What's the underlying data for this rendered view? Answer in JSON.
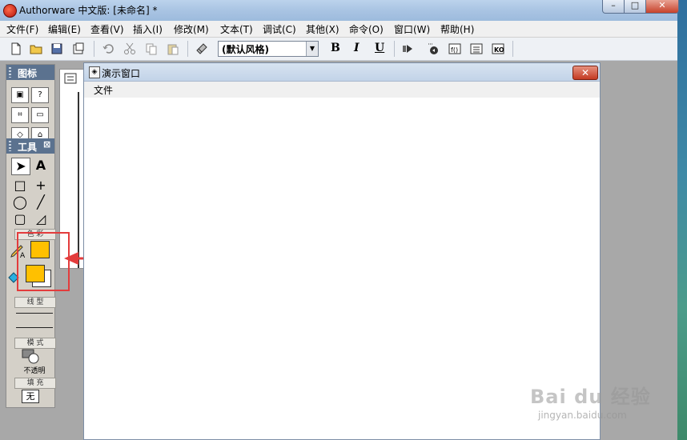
{
  "window": {
    "title": "Authorware 中文版: [未命名] *",
    "min_glyph": "–",
    "max_glyph": "□",
    "close_glyph": "✕"
  },
  "menu": {
    "items": [
      "文件(F)",
      "编辑(E)",
      "查看(V)",
      "插入(I)",
      "修改(M)",
      "文本(T)",
      "调试(C)",
      "其他(X)",
      "命令(O)",
      "窗口(W)",
      "帮助(H)"
    ]
  },
  "toolbar": {
    "style_select_value": "(默认风格)",
    "bold_label": "B",
    "italic_label": "I",
    "underline_label": "U"
  },
  "icons_palette": {
    "header": "图标",
    "tools_header": "工具",
    "tools_close": "⊠",
    "color_label": "色 彩",
    "line_label": "线 型",
    "mode_label": "模 式",
    "mode_value": "不透明",
    "fill_label": "填 充",
    "fill_value": "无",
    "text_tool_glyph": "A",
    "fill_color": "#ffc000"
  },
  "presentation_window": {
    "title": "演示窗口",
    "menu_file": "文件",
    "close_glyph": "✕"
  },
  "watermark": {
    "logo": "Bai du 经验",
    "url": "jingyan.baidu.com"
  }
}
